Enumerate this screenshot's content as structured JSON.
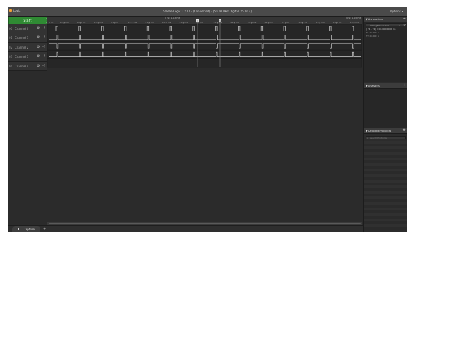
{
  "titlebar": {
    "logo_text": "Logic",
    "title": "Saleae Logic 1.2.17 - [Connected] - [50.00 MHz Digital, 25.00 s]",
    "options_label": "Options"
  },
  "start_label": "Start",
  "channels": [
    {
      "num": "00",
      "name": "Channel 0"
    },
    {
      "num": "01",
      "name": "Channel 1"
    },
    {
      "num": "02",
      "name": "Channel 2"
    },
    {
      "num": "03",
      "name": "Channel 3"
    },
    {
      "num": "04",
      "name": "Channel 4"
    }
  ],
  "timeline": {
    "center_label": "0 s : 143 ms",
    "right_label": "0 s : 145 ms",
    "left_label": "0 ms",
    "ticks": [
      "+0.4 ms",
      "+0.6 ms",
      "+0.8 ms",
      "+1 ms",
      "+1.2 ms",
      "+1.4 ms",
      "+1.6 ms",
      "+1.8 ms",
      "+2 ms",
      "+2.2 ms",
      "+2.4 ms",
      "+2.6 ms",
      "+2.8 ms",
      "+3 ms",
      "+3.2 ms",
      "+3.4 ms",
      "+3.6 ms",
      "+3.8 ms"
    ],
    "marker_labels": [
      "1",
      "2"
    ]
  },
  "tabs": {
    "capture_label": "Capture",
    "add_label": "+"
  },
  "annotations": {
    "title": "Annotations",
    "add_label": "+",
    "select_label": "Timing Marker Pair",
    "measure": "| T1 - T2 | = 0.00000008 ms",
    "lines": [
      "T1: 0.0003 s",
      "T2: 0.0003 s"
    ]
  },
  "analyzers": {
    "title": "Analyzers",
    "add_label": "+"
  },
  "decoded": {
    "title": "Decoded Protocols",
    "search_placeholder": "Search Protocols"
  },
  "colors": {
    "accent_start": "#2f8a33",
    "marker": "#d9a04a",
    "signal": "#cfcfcf"
  }
}
